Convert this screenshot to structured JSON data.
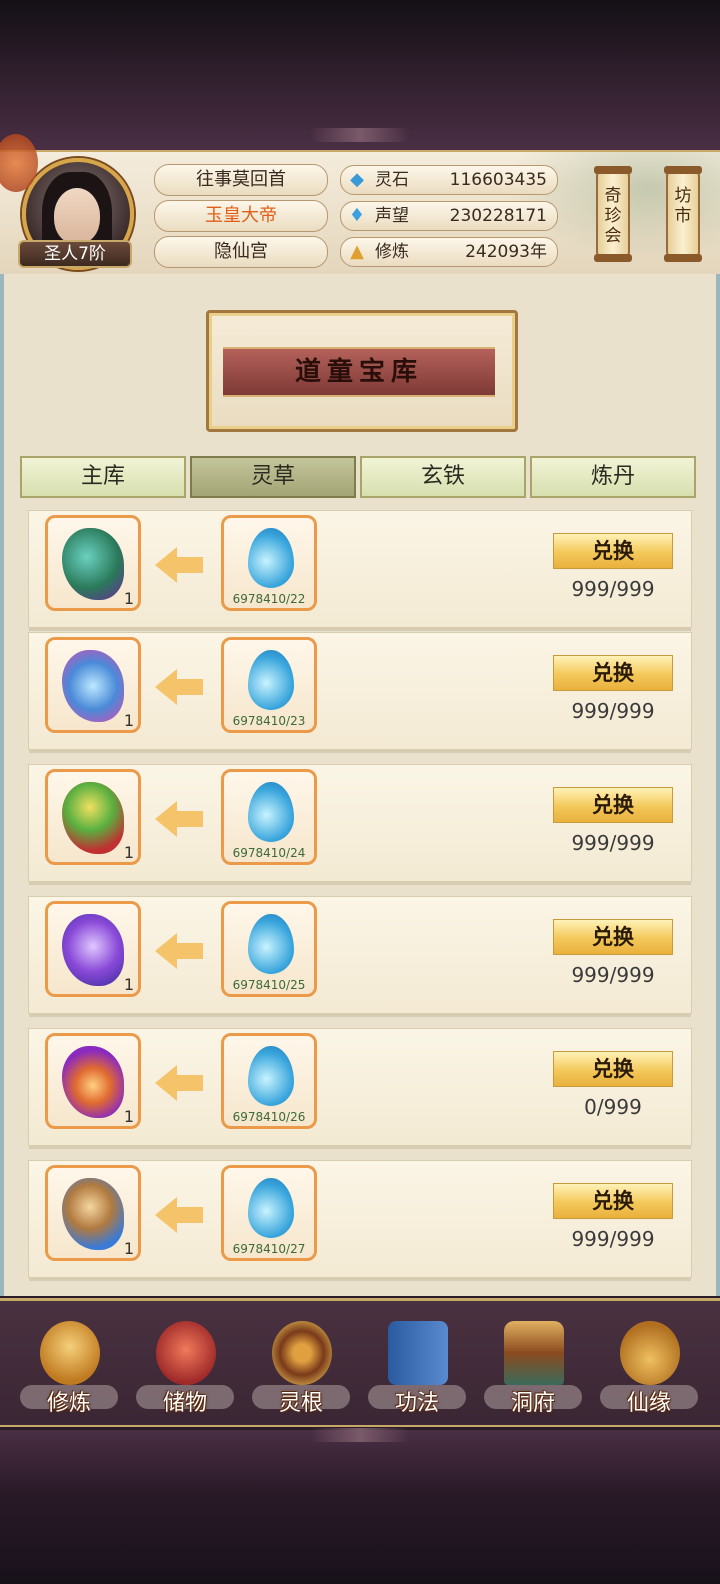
{
  "header": {
    "rank": "圣人7阶",
    "titles": [
      "往事莫回首",
      "玉皇大帝",
      "隐仙宫"
    ],
    "highlight_color": "#e0601a",
    "stats": [
      {
        "icon": "spirit-stone-icon",
        "label": "灵石",
        "value": "116603435"
      },
      {
        "icon": "prestige-icon",
        "label": "声望",
        "value": "230228171"
      },
      {
        "icon": "cultivation-icon",
        "label": "修炼",
        "value": "242093年"
      }
    ],
    "side_buttons": [
      "奇珍会",
      "坊市"
    ]
  },
  "banner": {
    "title": "道童宝库"
  },
  "tabs": [
    {
      "label": "主库",
      "active": false
    },
    {
      "label": "灵草",
      "active": true
    },
    {
      "label": "玄铁",
      "active": false
    },
    {
      "label": "炼丹",
      "active": false
    }
  ],
  "exchange_items": [
    {
      "item": "peacock-feather-herb",
      "count": "1",
      "cost_code": "6978410/22",
      "button": "兑换",
      "limit": "999/999"
    },
    {
      "item": "glowing-blue-flower",
      "count": "1",
      "cost_code": "6978410/23",
      "button": "兑换",
      "limit": "999/999"
    },
    {
      "item": "rainbow-fruit",
      "count": "1",
      "cost_code": "6978410/24",
      "button": "兑换",
      "limit": "999/999"
    },
    {
      "item": "purple-lotus",
      "count": "1",
      "cost_code": "6978410/25",
      "button": "兑换",
      "limit": "999/999"
    },
    {
      "item": "flame-lotus",
      "count": "1",
      "cost_code": "6978410/26",
      "button": "兑换",
      "limit": "0/999"
    },
    {
      "item": "phoenix-plume",
      "count": "1",
      "cost_code": "6978410/27",
      "button": "兑换",
      "limit": "999/999"
    }
  ],
  "bottom_nav": [
    {
      "icon": "meditation-icon",
      "label": "修炼"
    },
    {
      "icon": "pouch-icon",
      "label": "储物"
    },
    {
      "icon": "spirit-root-icon",
      "label": "灵根"
    },
    {
      "icon": "scroll-book-icon",
      "label": "功法"
    },
    {
      "icon": "cave-palace-icon",
      "label": "洞府"
    },
    {
      "icon": "gourd-icon",
      "label": "仙缘"
    }
  ]
}
